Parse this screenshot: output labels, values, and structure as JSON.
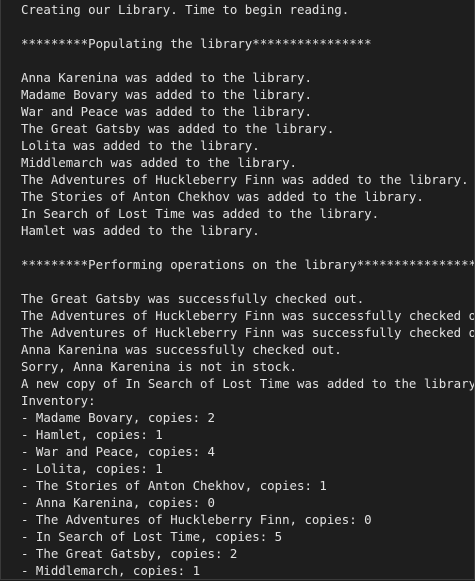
{
  "console": {
    "lines": [
      "Creating our Library. Time to begin reading.",
      "",
      "*********Populating the library****************",
      "",
      "Anna Karenina was added to the library.",
      "Madame Bovary was added to the library.",
      "War and Peace was added to the library.",
      "The Great Gatsby was added to the library.",
      "Lolita was added to the library.",
      "Middlemarch was added to the library.",
      "The Adventures of Huckleberry Finn was added to the library.",
      "The Stories of Anton Chekhov was added to the library.",
      "In Search of Lost Time was added to the library.",
      "Hamlet was added to the library.",
      "",
      "*********Performing operations on the library****************",
      "",
      "The Great Gatsby was successfully checked out.",
      "The Adventures of Huckleberry Finn was successfully checked out.",
      "The Adventures of Huckleberry Finn was successfully checked out.",
      "Anna Karenina was successfully checked out.",
      "Sorry, Anna Karenina is not in stock.",
      "A new copy of In Search of Lost Time was added to the library.",
      "Inventory:",
      "- Madame Bovary, copies: 2",
      "- Hamlet, copies: 1",
      "- War and Peace, copies: 4",
      "- Lolita, copies: 1",
      "- The Stories of Anton Chekhov, copies: 1",
      "- Anna Karenina, copies: 0",
      "- The Adventures of Huckleberry Finn, copies: 0",
      "- In Search of Lost Time, copies: 5",
      "- The Great Gatsby, copies: 2",
      "- Middlemarch, copies: 1"
    ]
  }
}
